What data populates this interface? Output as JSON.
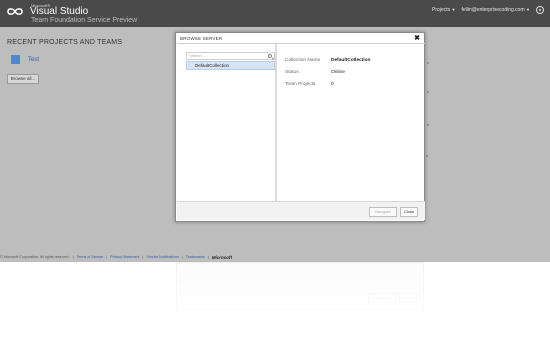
{
  "header": {
    "brand_microsoft": "Microsoft®",
    "brand_name": "Visual Studio",
    "brand_subtitle": "Team Foundation Service Preview",
    "nav_projects": "Projects",
    "user_email": "fellin@enterprisecoding.com"
  },
  "main": {
    "section_title": "RECENT PROJECTS AND TEAMS",
    "projects": [
      {
        "name": "Test"
      }
    ],
    "browse_button": "Browse all..."
  },
  "dialog": {
    "title": "BROWSE SERVER",
    "close_glyph": "✖",
    "search_placeholder": "Search...",
    "tree_items": [
      {
        "label": "DefaultCollection"
      }
    ],
    "details": [
      {
        "label": "Collection Name",
        "value": "DefaultCollection"
      },
      {
        "label": "Status",
        "value": "Online"
      },
      {
        "label": "Team Projects",
        "value": "0"
      }
    ],
    "navigate_button": "Navigate",
    "close_button": "Close"
  },
  "footer": {
    "copyright": "© Microsoft Corporation. All rights reserved.",
    "links": [
      "Terms of Service",
      "Privacy Statement",
      "Service Notifications",
      "Trademarks"
    ],
    "logo_text": "Microsoft"
  },
  "colors": {
    "header_bg": "#4a4a4a",
    "page_bg": "#bdbdbd",
    "link": "#2a5fad",
    "selection": "#d7e4f5",
    "project_tile": "#4f86cf"
  }
}
